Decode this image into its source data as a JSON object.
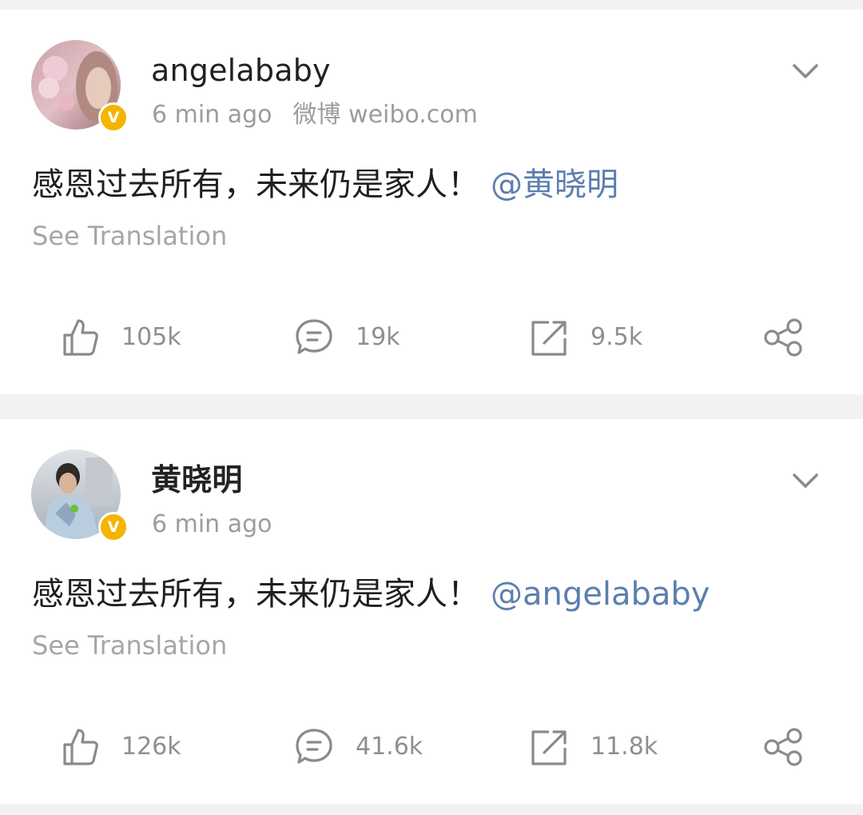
{
  "posts": [
    {
      "username": "angelababy",
      "time": "6 min ago",
      "source": "微博 weibo.com",
      "text": "感恩过去所有，未来仍是家人！",
      "mention": "@黄晓明",
      "translate": "See Translation",
      "likes": "105k",
      "comments": "19k",
      "reposts": "9.5k",
      "verified_badge": "V"
    },
    {
      "username": "黄晓明",
      "time": "6 min ago",
      "text": "感恩过去所有，未来仍是家人！",
      "mention": "@angelababy",
      "translate": "See Translation",
      "likes": "126k",
      "comments": "41.6k",
      "reposts": "11.8k",
      "verified_badge": "V"
    }
  ],
  "icons": {
    "menu": "chevron-down-icon",
    "like": "thumbs-up-icon",
    "comment": "comment-icon",
    "repost": "repost-icon",
    "share": "share-icon"
  },
  "colors": {
    "mention": "#5b7fae",
    "badge": "#f5b400",
    "icon_gray": "#8a8a8a",
    "background": "#f2f2f2"
  }
}
